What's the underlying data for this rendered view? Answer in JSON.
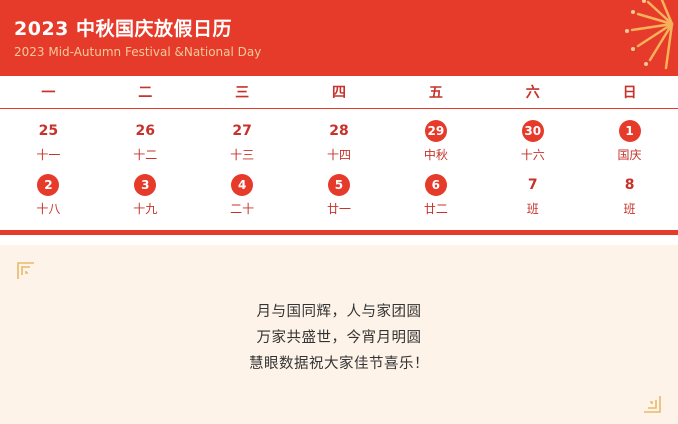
{
  "header": {
    "title": "2023 中秋国庆放假日历",
    "subtitle": "2023 Mid-Autumn Festival &National Day",
    "decoration_icon": "firework-icon"
  },
  "weekdays": [
    "一",
    "二",
    "三",
    "四",
    "五",
    "六",
    "日"
  ],
  "weeks": [
    [
      {
        "num": "25",
        "sub": "十一",
        "holiday": false
      },
      {
        "num": "26",
        "sub": "十二",
        "holiday": false
      },
      {
        "num": "27",
        "sub": "十三",
        "holiday": false
      },
      {
        "num": "28",
        "sub": "十四",
        "holiday": false
      },
      {
        "num": "29",
        "sub": "中秋",
        "holiday": true
      },
      {
        "num": "30",
        "sub": "十六",
        "holiday": true
      },
      {
        "num": "1",
        "sub": "国庆",
        "holiday": true
      }
    ],
    [
      {
        "num": "2",
        "sub": "十八",
        "holiday": true
      },
      {
        "num": "3",
        "sub": "十九",
        "holiday": true
      },
      {
        "num": "4",
        "sub": "二十",
        "holiday": true
      },
      {
        "num": "5",
        "sub": "廿一",
        "holiday": true
      },
      {
        "num": "6",
        "sub": "廿二",
        "holiday": true
      },
      {
        "num": "7",
        "sub": "班",
        "holiday": false
      },
      {
        "num": "8",
        "sub": "班",
        "holiday": false
      }
    ]
  ],
  "greeting": {
    "lines": [
      "月与国同辉，人与家团圆",
      "万家共盛世，今宵月明圆",
      "慧眼数据祝大家佳节喜乐！"
    ]
  },
  "colors": {
    "accent": "#e63a2b",
    "text_red": "#c7322a",
    "bottom_bg": "#fdf3e8",
    "subtitle": "#f6c99a"
  }
}
